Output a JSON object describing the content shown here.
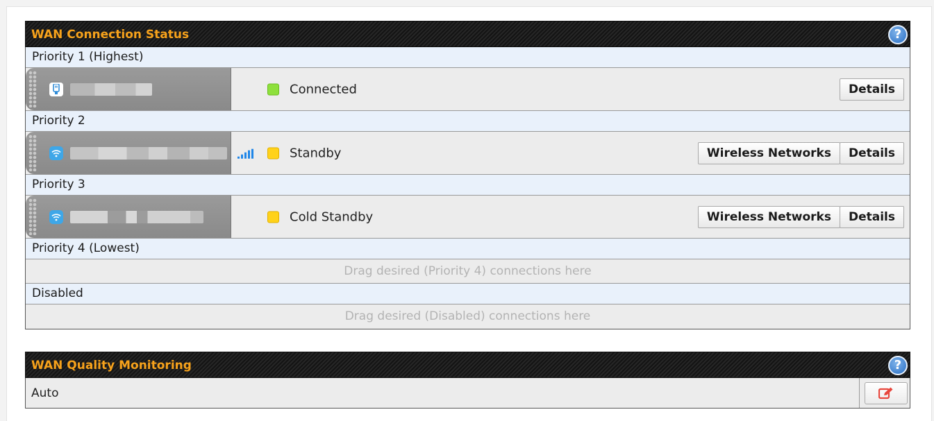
{
  "wan_status": {
    "title": "WAN Connection Status",
    "help_icon": "help-icon",
    "priority1": {
      "label": "Priority 1 (Highest)",
      "connection": {
        "icon": "usb-modem-icon",
        "status": "Connected",
        "status_color": "#8ee03c",
        "details_label": "Details"
      }
    },
    "priority2": {
      "label": "Priority 2",
      "connection": {
        "icon": "wifi-icon",
        "signal_icon": "signal-bars-icon",
        "status": "Standby",
        "status_color": "#ffd21a",
        "wireless_label": "Wireless Networks",
        "details_label": "Details"
      }
    },
    "priority3": {
      "label": "Priority 3",
      "connection": {
        "icon": "wifi-icon",
        "status": "Cold Standby",
        "status_color": "#ffd21a",
        "wireless_label": "Wireless Networks",
        "details_label": "Details"
      }
    },
    "priority4": {
      "label": "Priority 4 (Lowest)",
      "placeholder": "Drag desired (Priority 4) connections here"
    },
    "disabled": {
      "label": "Disabled",
      "placeholder": "Drag desired (Disabled) connections here"
    }
  },
  "wan_quality": {
    "title": "WAN Quality Monitoring",
    "help_icon": "help-icon",
    "value": "Auto",
    "edit_icon": "edit-icon"
  },
  "colors": {
    "header_text": "#f7a21b",
    "priority_row_bg": "#e9f1fb",
    "row_bg": "#ececec",
    "edit_icon": "#e8463c"
  }
}
